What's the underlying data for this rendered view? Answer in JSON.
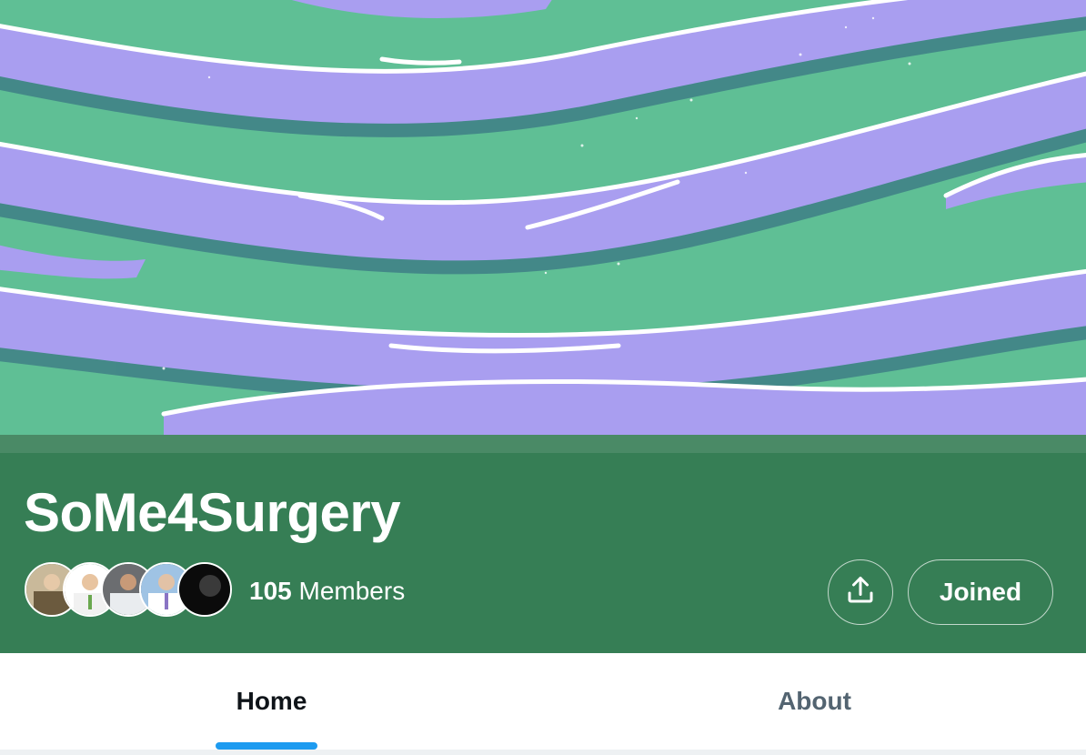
{
  "community": {
    "name": "SoMe4Surgery",
    "member_count": "105",
    "member_label": "Members",
    "banner_colors": {
      "green": "#5fbf95",
      "purple": "#a99ef0",
      "shadow": "#3f7f86",
      "white": "#ffffff"
    },
    "header_color": "#367e55",
    "strip_color": "#4a8a66"
  },
  "actions": {
    "share_icon": "share-upload-icon",
    "joined_label": "Joined"
  },
  "avatars": [
    {
      "name": "member-avatar-1"
    },
    {
      "name": "member-avatar-2"
    },
    {
      "name": "member-avatar-3"
    },
    {
      "name": "member-avatar-4"
    },
    {
      "name": "member-avatar-5"
    }
  ],
  "tabs": [
    {
      "label": "Home",
      "active": true
    },
    {
      "label": "About",
      "active": false
    }
  ],
  "accent_color": "#1d9bf0"
}
